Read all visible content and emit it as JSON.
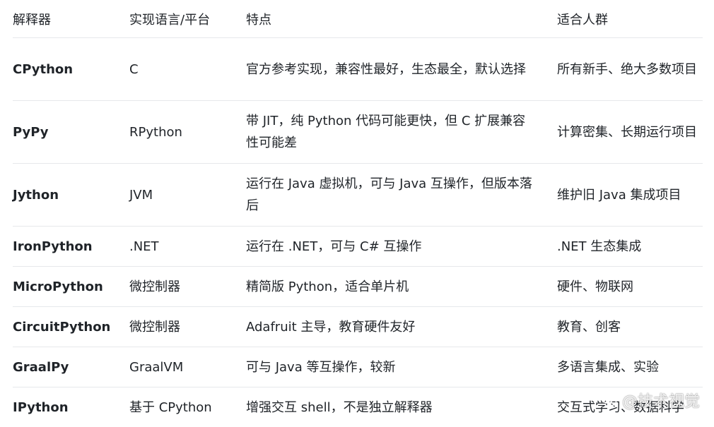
{
  "table": {
    "headers": [
      "解释器",
      "实现语言/平台",
      "特点",
      "适合人群"
    ],
    "rows": [
      {
        "name": "CPython",
        "platform": "C",
        "features": "官方参考实现，兼容性最好，生态最全，默认选择",
        "audience": "所有新手、绝大多数项目"
      },
      {
        "name": "PyPy",
        "platform": "RPython",
        "features": "带 JIT，纯 Python 代码可能更快，但 C 扩展兼容性可能差",
        "audience": "计算密集、长期运行项目"
      },
      {
        "name": "Jython",
        "platform": "JVM",
        "features": "运行在 Java 虚拟机，可与 Java 互操作，但版本落后",
        "audience": "维护旧 Java 集成项目"
      },
      {
        "name": "IronPython",
        "platform": ".NET",
        "features": "运行在 .NET，可与 C# 互操作",
        "audience": ".NET 生态集成"
      },
      {
        "name": "MicroPython",
        "platform": "微控制器",
        "features": "精简版 Python，适合单片机",
        "audience": "硬件、物联网"
      },
      {
        "name": "CircuitPython",
        "platform": "微控制器",
        "features": "Adafruit 主导，教育硬件友好",
        "audience": "教育、创客"
      },
      {
        "name": "GraalPy",
        "platform": "GraalVM",
        "features": "可与 Java 等互操作，较新",
        "audience": "多语言集成、实验"
      },
      {
        "name": "IPython",
        "platform": "基于 CPython",
        "features": "增强交互 shell，不是独立解释器",
        "audience": "交互式学习、数据科学"
      }
    ]
  },
  "watermark": {
    "text": "@技术视觉",
    "icon": "wechat-icon"
  }
}
